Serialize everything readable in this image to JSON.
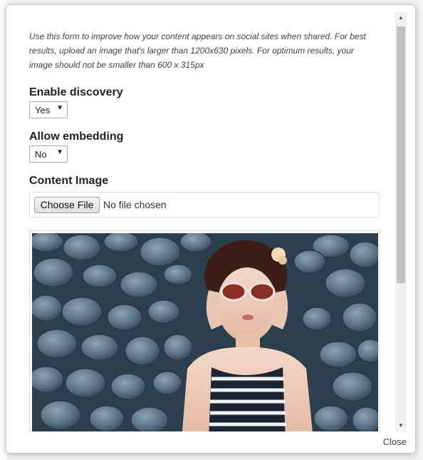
{
  "modal": {
    "intro_text": "Use this form to improve how your content appears on social sites when shared. For best results, upload an image that's larger than 1200x630 pixels. For optimum results, your image should not be smaller than 600 x 315px",
    "enable_discovery": {
      "label": "Enable discovery",
      "value": "Yes"
    },
    "allow_embedding": {
      "label": "Allow embedding",
      "value": "No"
    },
    "content_image": {
      "label": "Content Image",
      "choose_button": "Choose File",
      "file_status": "No file chosen"
    },
    "close_label": "Close"
  },
  "icons": {
    "dropdown": "caret-down-icon",
    "scroll_up": "arrow-up-icon",
    "scroll_down": "arrow-down-icon"
  },
  "colors": {
    "background_numbers": "#8fb2d6",
    "modal_border": "#c8c8c8"
  }
}
